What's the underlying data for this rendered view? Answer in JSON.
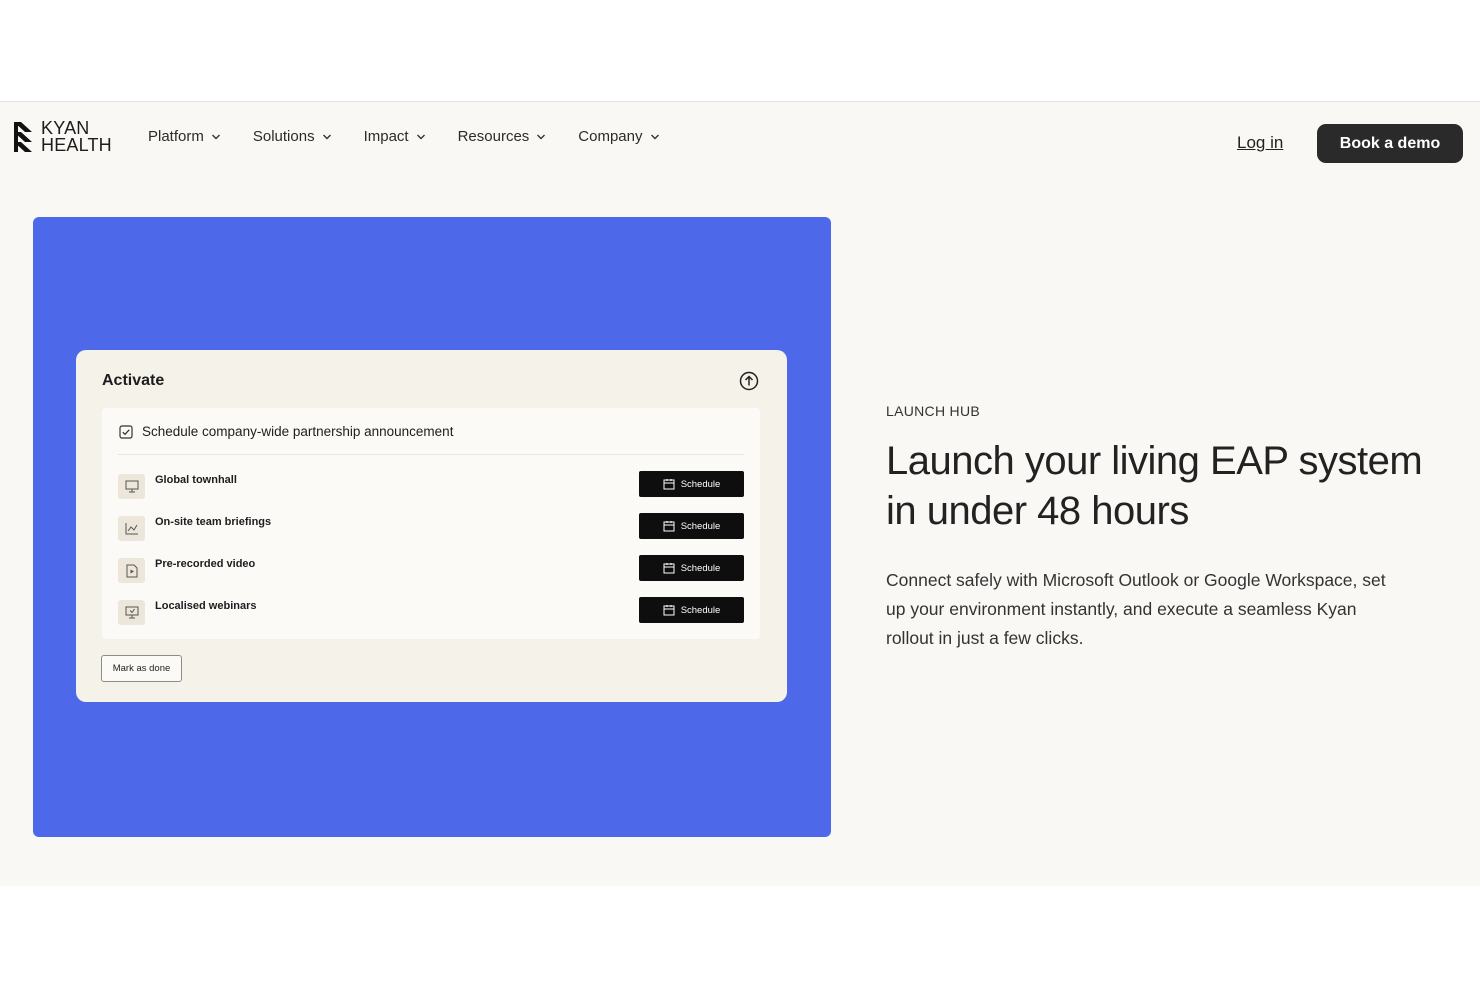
{
  "header": {
    "logo_line1": "KYAN",
    "logo_line2": "HEALTH",
    "nav": [
      {
        "label": "Platform"
      },
      {
        "label": "Solutions"
      },
      {
        "label": "Impact"
      },
      {
        "label": "Resources"
      },
      {
        "label": "Company"
      }
    ],
    "login_label": "Log in",
    "demo_label": "Book a demo"
  },
  "panel": {
    "color": "#4d69ea",
    "card_title": "Activate",
    "task_label": "Schedule company-wide partnership announcement",
    "rows": [
      {
        "label": "Global townhall",
        "icon": "presentation-icon",
        "button": "Schedule"
      },
      {
        "label": "On-site team briefings",
        "icon": "chart-icon",
        "button": "Schedule"
      },
      {
        "label": "Pre-recorded video",
        "icon": "video-file-icon",
        "button": "Schedule"
      },
      {
        "label": "Localised webinars",
        "icon": "monitor-icon",
        "button": "Schedule"
      }
    ],
    "done_label": "Mark as done"
  },
  "content": {
    "eyebrow": "LAUNCH HUB",
    "headline": "Launch your living EAP system in under 48 hours",
    "body": "Connect safely with Microsoft Outlook or Google Workspace, set up your environment instantly, and execute a seamless Kyan rollout in just a few clicks."
  }
}
